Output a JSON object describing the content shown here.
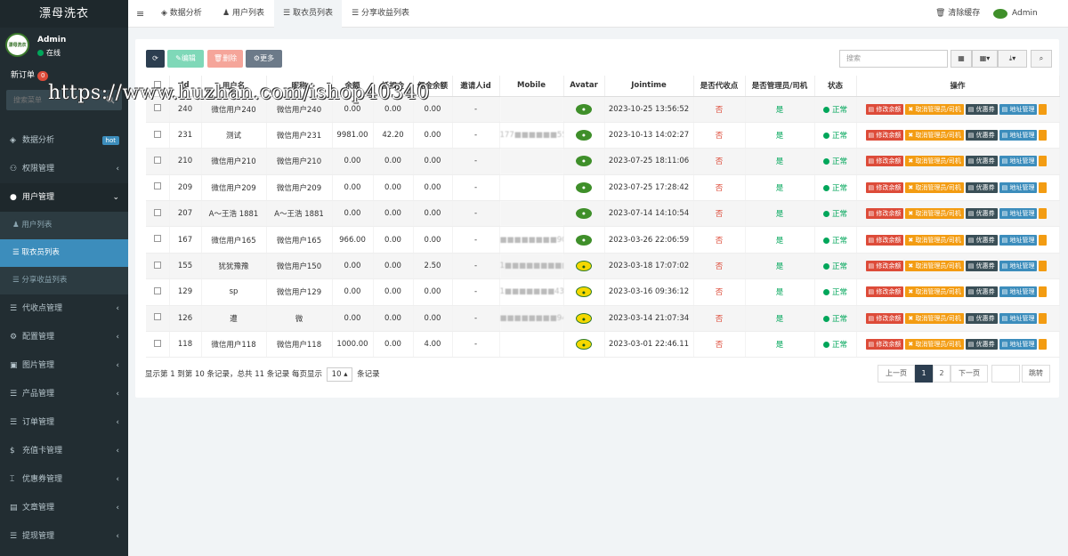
{
  "app": {
    "title": "漂母洗衣"
  },
  "user": {
    "name": "Admin",
    "status": "在线",
    "avatar_text": "漂母洗衣"
  },
  "neworder": {
    "label": "新订单",
    "count": "0"
  },
  "sidebar": {
    "search_placeholder": "搜索菜单",
    "items": [
      {
        "label": "数据分析",
        "badge": "hot"
      },
      {
        "label": "权限管理"
      },
      {
        "label": "用户管理"
      },
      {
        "label": "代收点管理"
      },
      {
        "label": "配置管理"
      },
      {
        "label": "图片管理"
      },
      {
        "label": "产品管理"
      },
      {
        "label": "订单管理"
      },
      {
        "label": "充值卡管理"
      },
      {
        "label": "优惠券管理"
      },
      {
        "label": "文章管理"
      },
      {
        "label": "提现管理"
      }
    ],
    "subitems": [
      {
        "label": "用户列表"
      },
      {
        "label": "取衣员列表"
      },
      {
        "label": "分享收益列表"
      }
    ]
  },
  "topbar": {
    "tabs": [
      {
        "label": "数据分析"
      },
      {
        "label": "用户列表"
      },
      {
        "label": "取衣员列表"
      },
      {
        "label": "分享收益列表"
      }
    ],
    "clear_cache": "清除缓存",
    "admin": "Admin"
  },
  "toolbar": {
    "edit": "编辑",
    "delete": "删除",
    "more": "更多",
    "search_placeholder": "搜索"
  },
  "table": {
    "headers": [
      "Id",
      "用户名",
      "昵称",
      "余额",
      "抵扣金",
      "佣金余额",
      "邀请人id",
      "Mobile",
      "Avatar",
      "Jointime",
      "是否代收点",
      "是否管理员/司机",
      "状态",
      "操作"
    ],
    "rows": [
      {
        "id": "240",
        "username": "微信用户240",
        "nickname": "微信用户240",
        "balance": "0.00",
        "deduct": "0.00",
        "commission": "0.00",
        "inviter": "-",
        "mobile": "",
        "avatar": "g",
        "jointime": "2023-10-25 13:56:52",
        "collect": "否",
        "admin": "是",
        "status": "正常"
      },
      {
        "id": "231",
        "username": "测试",
        "nickname": "微信用户231",
        "balance": "9981.00",
        "deduct": "42.20",
        "commission": "0.00",
        "inviter": "-",
        "mobile": "177■■■■■■55",
        "avatar": "g",
        "jointime": "2023-10-13 14:02:27",
        "collect": "否",
        "admin": "是",
        "status": "正常"
      },
      {
        "id": "210",
        "username": "微信用户210",
        "nickname": "微信用户210",
        "balance": "0.00",
        "deduct": "0.00",
        "commission": "0.00",
        "inviter": "-",
        "mobile": "",
        "avatar": "g",
        "jointime": "2023-07-25 18:11:06",
        "collect": "否",
        "admin": "是",
        "status": "正常"
      },
      {
        "id": "209",
        "username": "微信用户209",
        "nickname": "微信用户209",
        "balance": "0.00",
        "deduct": "0.00",
        "commission": "0.00",
        "inviter": "-",
        "mobile": "",
        "avatar": "g",
        "jointime": "2023-07-25 17:28:42",
        "collect": "否",
        "admin": "是",
        "status": "正常"
      },
      {
        "id": "207",
        "username": "A～王浩 1881",
        "nickname": "A～王浩 1881",
        "balance": "0.00",
        "deduct": "0.00",
        "commission": "0.00",
        "inviter": "-",
        "mobile": "",
        "avatar": "g",
        "jointime": "2023-07-14 14:10:54",
        "collect": "否",
        "admin": "是",
        "status": "正常"
      },
      {
        "id": "167",
        "username": "微信用户165",
        "nickname": "微信用户165",
        "balance": "966.00",
        "deduct": "0.00",
        "commission": "0.00",
        "inviter": "-",
        "mobile": "■■■■■■■■90",
        "avatar": "g",
        "jointime": "2023-03-26 22:06:59",
        "collect": "否",
        "admin": "是",
        "status": "正常"
      },
      {
        "id": "155",
        "username": "犹犹豫豫",
        "nickname": "微信用户150",
        "balance": "0.00",
        "deduct": "0.00",
        "commission": "2.50",
        "inviter": "-",
        "mobile": "1■■■■■■■■■",
        "avatar": "y",
        "jointime": "2023-03-18 17:07:02",
        "collect": "否",
        "admin": "是",
        "status": "正常"
      },
      {
        "id": "129",
        "username": "sp",
        "nickname": "微信用户129",
        "balance": "0.00",
        "deduct": "0.00",
        "commission": "0.00",
        "inviter": "-",
        "mobile": "1■■■■■■■43",
        "avatar": "y",
        "jointime": "2023-03-16 09:36:12",
        "collect": "否",
        "admin": "是",
        "status": "正常"
      },
      {
        "id": "126",
        "username": "遭",
        "nickname": "微",
        "balance": "0.00",
        "deduct": "0.00",
        "commission": "0.00",
        "inviter": "-",
        "mobile": "■■■■■■■■94",
        "avatar": "y",
        "jointime": "2023-03-14 21:07:34",
        "collect": "否",
        "admin": "是",
        "status": "正常"
      },
      {
        "id": "118",
        "username": "微信用户118",
        "nickname": "微信用户118",
        "balance": "1000.00",
        "deduct": "0.00",
        "commission": "4.00",
        "inviter": "-",
        "mobile": "",
        "avatar": "y",
        "jointime": "2023-03-01 22:46.11",
        "collect": "否",
        "admin": "是",
        "status": "正常"
      }
    ],
    "ops": [
      "修改余额",
      "取消管理员/司机",
      "优惠券",
      "地址管理"
    ]
  },
  "footer": {
    "summary_prefix": "显示第 1 到第 10 条记录，总共 11 条记录 每页显示",
    "page_size": "10",
    "summary_suffix": "条记录",
    "prev": "上一页",
    "pages": [
      "1",
      "2"
    ],
    "next": "下一页",
    "jump": "跳转"
  },
  "watermark": "https://www.huzhan.com/ishop40340",
  "colors": {
    "sidebar": "#222d32",
    "active": "#3c8dbc",
    "red": "#dd4b39",
    "orange": "#f39c12",
    "green": "#00a65a",
    "teal": "#18bc9c"
  }
}
